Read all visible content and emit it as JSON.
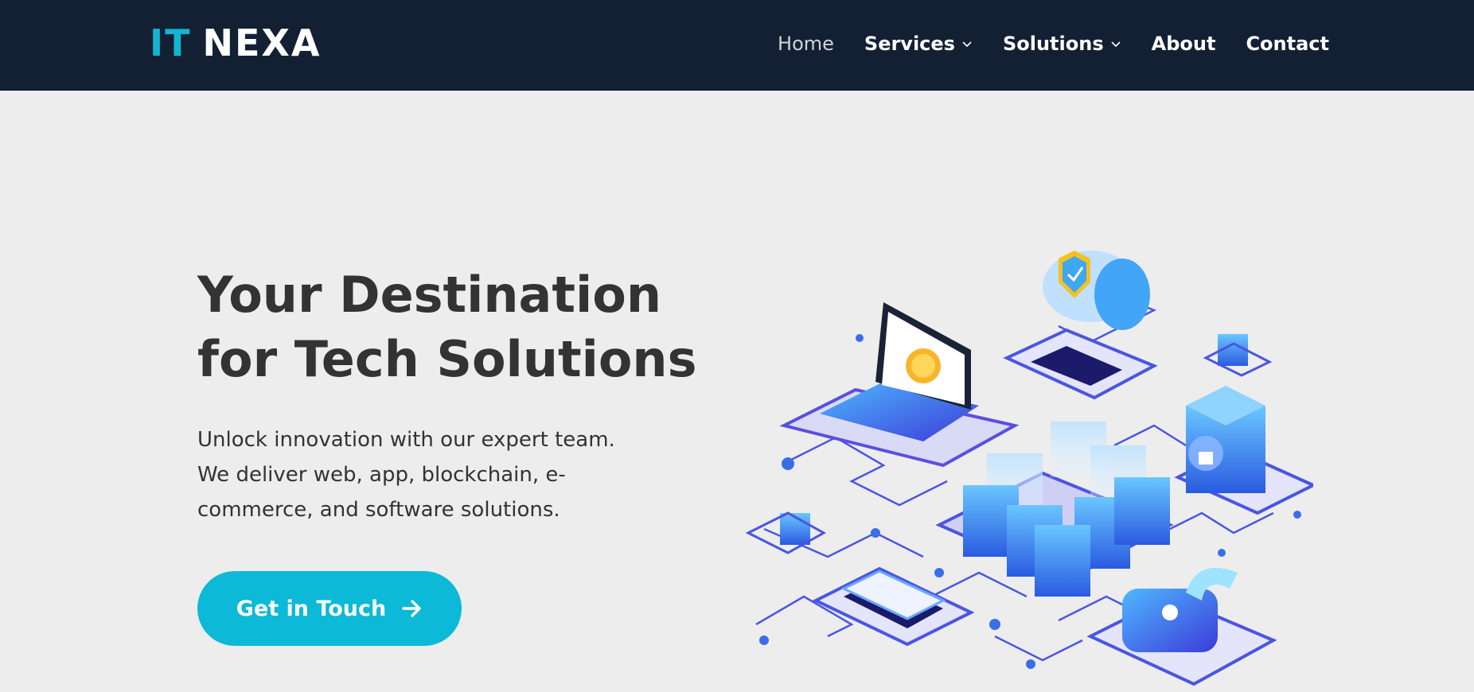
{
  "header": {
    "logo": {
      "part1": "IT",
      "part2": "NEXA"
    },
    "nav": [
      {
        "label": "Home",
        "active": true,
        "dropdown": false
      },
      {
        "label": "Services",
        "active": false,
        "dropdown": true
      },
      {
        "label": "Solutions",
        "active": false,
        "dropdown": true
      },
      {
        "label": "About",
        "active": false,
        "dropdown": false
      },
      {
        "label": "Contact",
        "active": false,
        "dropdown": false
      }
    ]
  },
  "hero": {
    "title_line1": "Your Destination",
    "title_line2": "for Tech Solutions",
    "subtitle_line1": "Unlock innovation with our expert team.",
    "subtitle_line2": "We deliver web, app, blockchain, e-",
    "subtitle_line3": "commerce, and software solutions.",
    "cta_label": "Get in Touch"
  },
  "colors": {
    "navbar_bg": "#132034",
    "accent": "#0cb9d6",
    "page_bg": "#ededed",
    "text_dark": "#333333"
  },
  "icons": {
    "nav_dropdown": "chevron-down-icon",
    "cta_arrow": "arrow-right-icon",
    "illustration": "isometric-tech-network-illustration"
  }
}
